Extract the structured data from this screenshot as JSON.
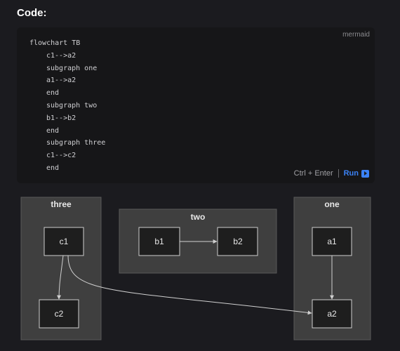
{
  "heading": "Code:",
  "code_block": {
    "language": "mermaid",
    "lines": [
      {
        "text": "flowchart TB",
        "indent": false
      },
      {
        "text": "c1-->a2",
        "indent": true
      },
      {
        "text": "subgraph one",
        "indent": true
      },
      {
        "text": "a1-->a2",
        "indent": true
      },
      {
        "text": "end",
        "indent": true
      },
      {
        "text": "subgraph two",
        "indent": true
      },
      {
        "text": "b1-->b2",
        "indent": true
      },
      {
        "text": "end",
        "indent": true
      },
      {
        "text": "subgraph three",
        "indent": true
      },
      {
        "text": "c1-->c2",
        "indent": true
      },
      {
        "text": "end",
        "indent": true
      }
    ],
    "shortcut": "Ctrl + Enter",
    "run_label": "Run"
  },
  "diagram": {
    "clusters": {
      "three": "three",
      "two": "two",
      "one": "one"
    },
    "nodes": {
      "c1": "c1",
      "c2": "c2",
      "b1": "b1",
      "b2": "b2",
      "a1": "a1",
      "a2": "a2"
    },
    "edges": [
      {
        "from": "c1",
        "to": "a2"
      },
      {
        "from": "a1",
        "to": "a2"
      },
      {
        "from": "b1",
        "to": "b2"
      },
      {
        "from": "c1",
        "to": "c2"
      }
    ]
  }
}
